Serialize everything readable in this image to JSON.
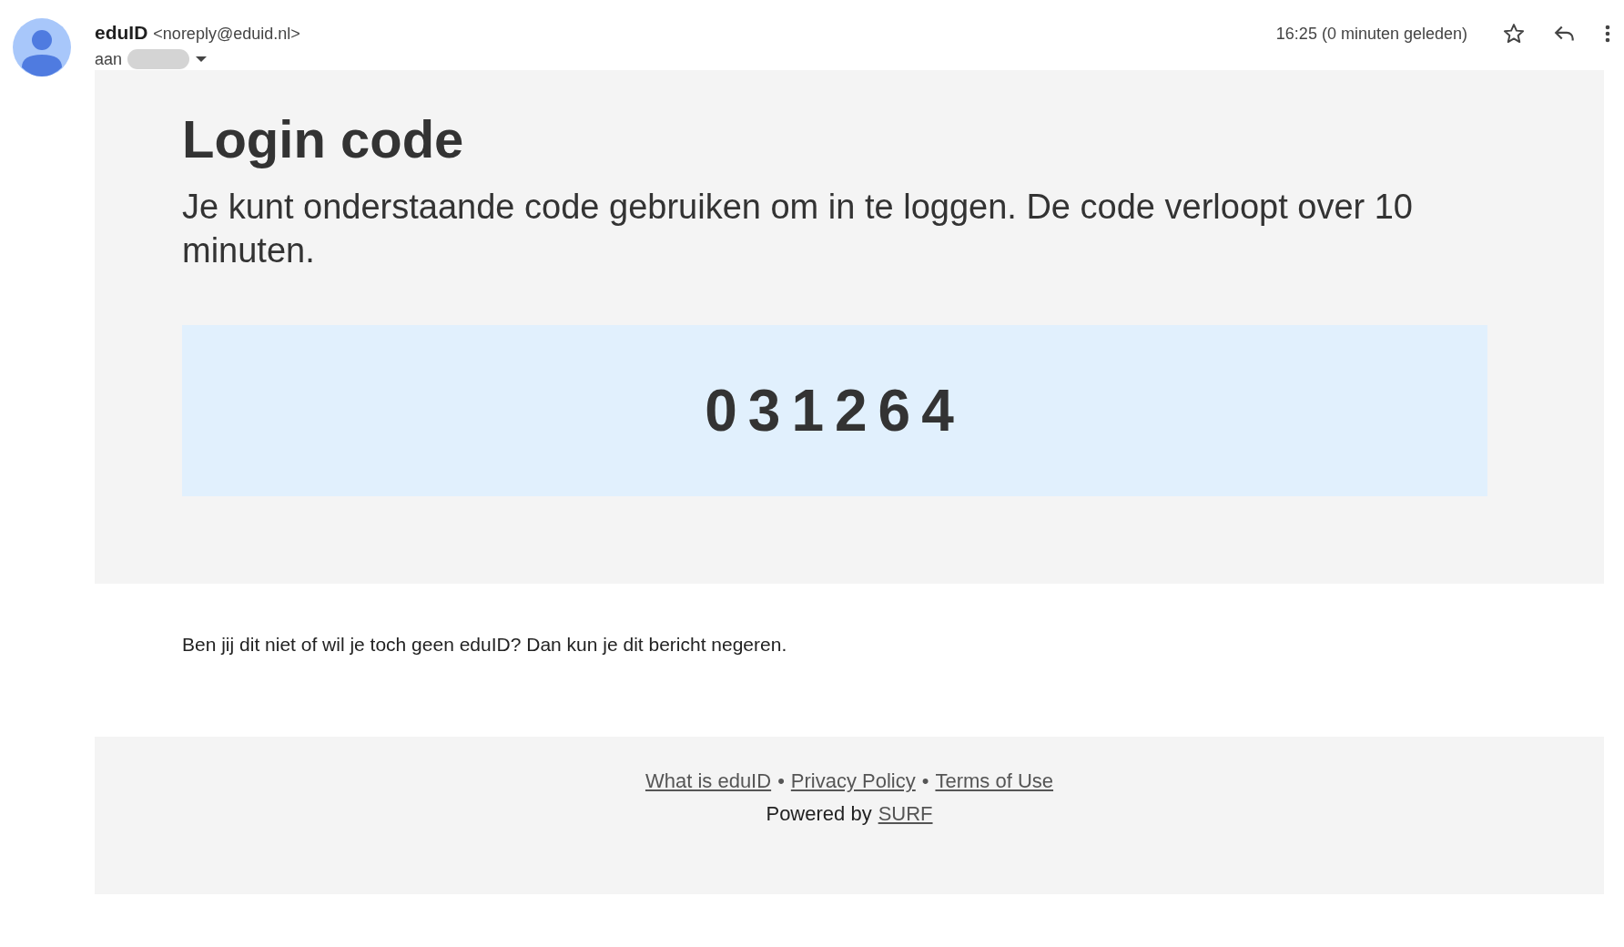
{
  "header": {
    "sender_name": "eduID",
    "sender_email": "<noreply@eduid.nl>",
    "recipient_label": "aan",
    "time": "16:25 (0 minuten geleden)",
    "starred": false
  },
  "message": {
    "title": "Login code",
    "intro": "Je kunt onderstaande code gebruiken om in te loggen. De code verloopt over 10 minuten.",
    "code": "031264",
    "note": "Ben jij dit niet of wil je toch geen eduID? Dan kun je dit bericht negeren."
  },
  "footer": {
    "links": [
      "What is eduID",
      "Privacy Policy",
      "Terms of Use"
    ],
    "separator": "•",
    "powered_by": "Powered by",
    "powered_link": "SURF"
  }
}
